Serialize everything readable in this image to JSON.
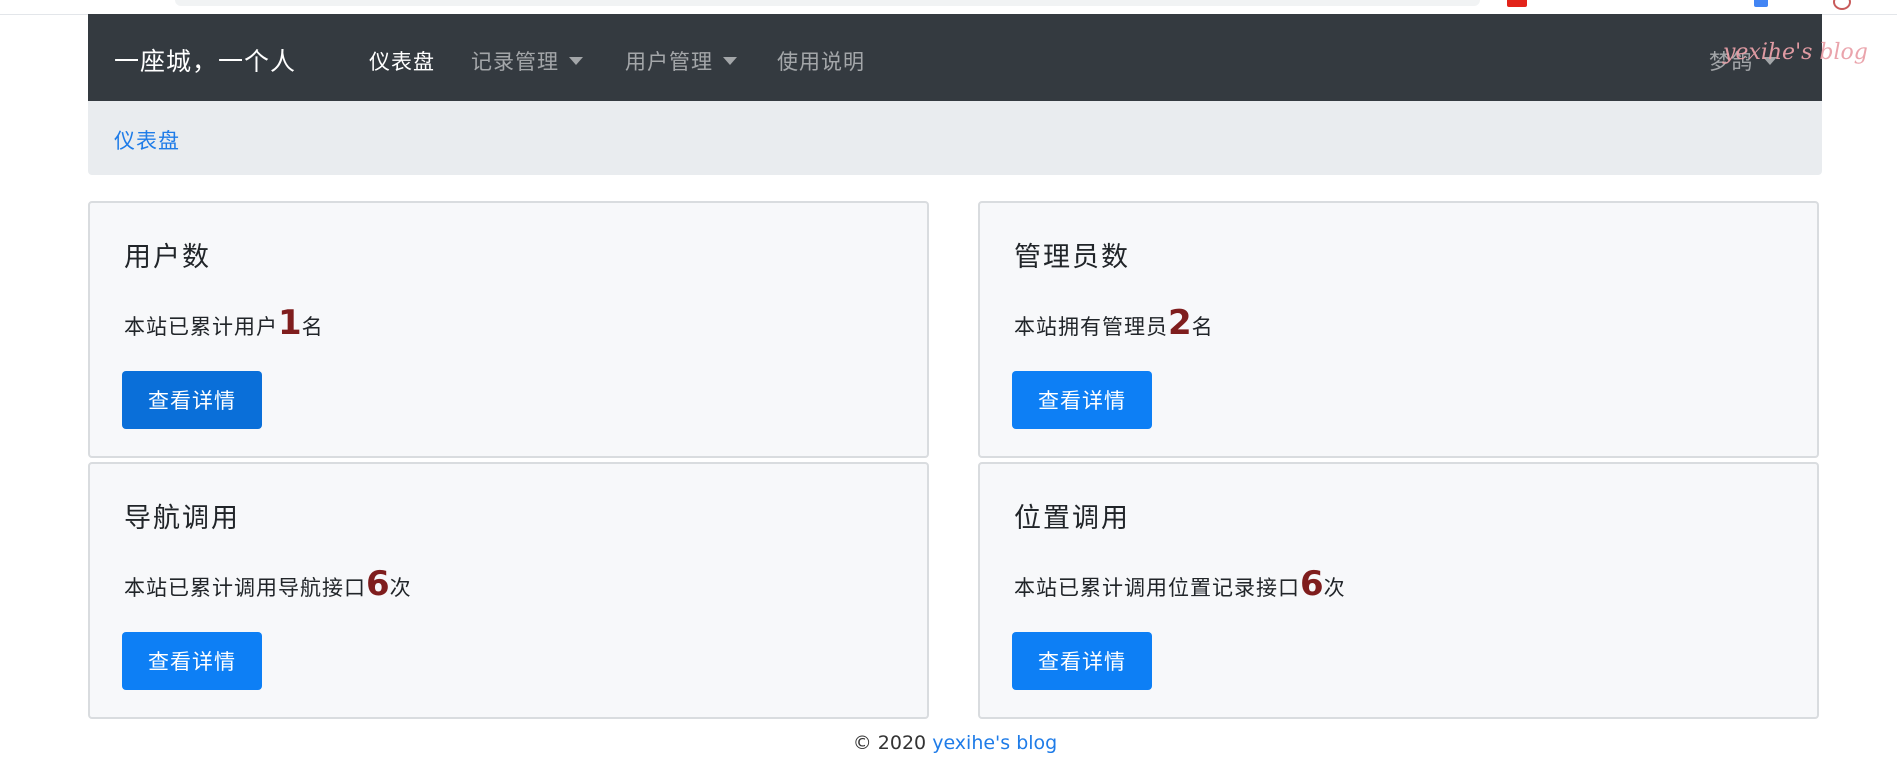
{
  "navbar": {
    "brand": "一座城，一个人",
    "items": [
      {
        "label": "仪表盘",
        "active": true
      },
      {
        "label": "记录管理",
        "dropdown": true
      },
      {
        "label": "用户管理",
        "dropdown": true
      },
      {
        "label": "使用说明"
      }
    ],
    "user_menu": "梦鸽",
    "watermark": "yexihe's blog"
  },
  "breadcrumb": {
    "current": "仪表盘"
  },
  "cards": [
    {
      "title": "用户数",
      "text_before": "本站已累计用户",
      "value": "1",
      "text_after": "名",
      "button": "查看详情"
    },
    {
      "title": "管理员数",
      "text_before": "本站拥有管理员",
      "value": "2",
      "text_after": "名",
      "button": "查看详情"
    },
    {
      "title": "导航调用",
      "text_before": "本站已累计调用导航接口",
      "value": "6",
      "text_after": "次",
      "button": "查看详情"
    },
    {
      "title": "位置调用",
      "text_before": "本站已累计调用位置记录接口",
      "value": "6",
      "text_after": "次",
      "button": "查看详情"
    }
  ],
  "footer": {
    "copyright": "© 2020",
    "link": "yexihe's blog"
  },
  "colors": {
    "navbar": "#343a40",
    "primary": "#0d7ff5",
    "number": "#7f1d1d",
    "link": "#1f7ce8",
    "card_bg": "#f7f8fa"
  }
}
